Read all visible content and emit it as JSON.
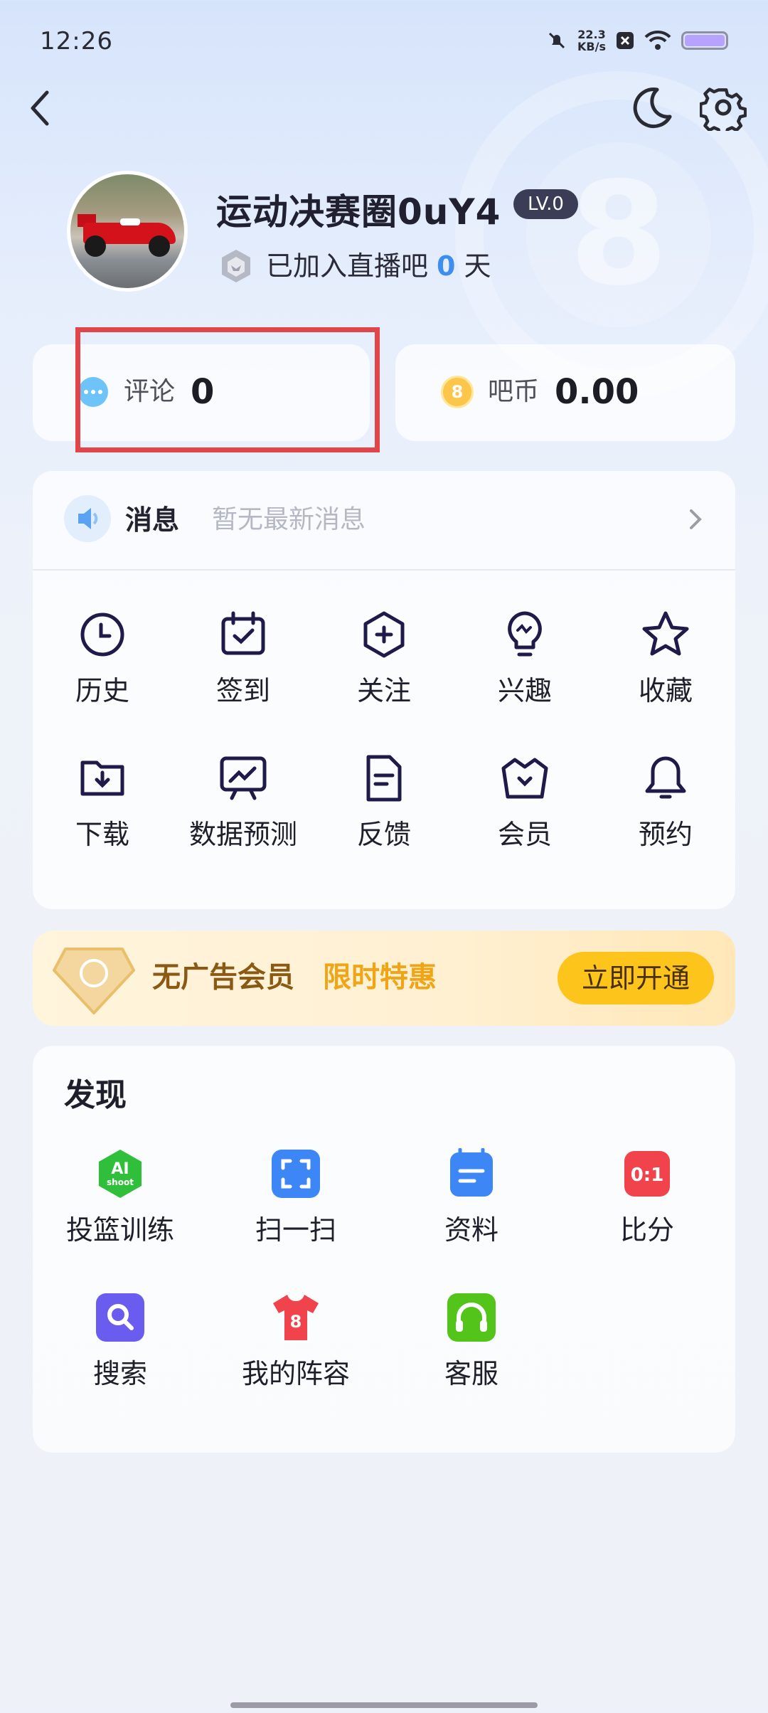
{
  "status_bar": {
    "time": "12:26",
    "net_speed_value": "22.3",
    "net_speed_unit": "KB/s"
  },
  "profile": {
    "username": "运动决赛圈0uY4",
    "level": "LV.0",
    "joined_prefix": "已加入直播吧",
    "joined_days": "0",
    "joined_suffix": "天"
  },
  "stats": {
    "comments_label": "评论",
    "comments_value": "0",
    "coins_label": "吧币",
    "coins_value": "0.00",
    "coin_glyph": "8"
  },
  "messages": {
    "title": "消息",
    "subtitle": "暂无最新消息"
  },
  "grid": [
    {
      "label": "历史",
      "icon": "clock-icon"
    },
    {
      "label": "签到",
      "icon": "calendar-check-icon"
    },
    {
      "label": "关注",
      "icon": "hexagon-plus-icon"
    },
    {
      "label": "兴趣",
      "icon": "lightbulb-icon"
    },
    {
      "label": "收藏",
      "icon": "star-icon"
    },
    {
      "label": "下载",
      "icon": "folder-download-icon"
    },
    {
      "label": "数据预测",
      "icon": "chart-board-icon"
    },
    {
      "label": "反馈",
      "icon": "document-icon"
    },
    {
      "label": "会员",
      "icon": "basket-icon"
    },
    {
      "label": "预约",
      "icon": "bell-icon"
    }
  ],
  "vip": {
    "text": "无广告会员",
    "promo": "限时特惠",
    "button": "立即开通"
  },
  "discover": {
    "title": "发现",
    "items": [
      {
        "label": "投篮训练",
        "icon": "ai-shoot-icon",
        "icon_text": "AI",
        "icon_subtext": "shoot",
        "color": "#2fbf3a"
      },
      {
        "label": "扫一扫",
        "icon": "scan-icon",
        "color": "#3d86f5"
      },
      {
        "label": "资料",
        "icon": "folder-info-icon",
        "color": "#3d86f5"
      },
      {
        "label": "比分",
        "icon": "score-icon",
        "icon_text": "0:1",
        "color": "#f0434c"
      },
      {
        "label": "搜索",
        "icon": "search-icon",
        "color": "#6b5cf0"
      },
      {
        "label": "我的阵容",
        "icon": "jersey-icon",
        "icon_text": "8",
        "color": "#f0434c"
      },
      {
        "label": "客服",
        "icon": "headset-icon",
        "color": "#52c41a"
      }
    ]
  },
  "colors": {
    "accent_blue": "#3c8ef0",
    "highlight_red": "#e0454a",
    "vip_gold": "#fdc41c"
  }
}
